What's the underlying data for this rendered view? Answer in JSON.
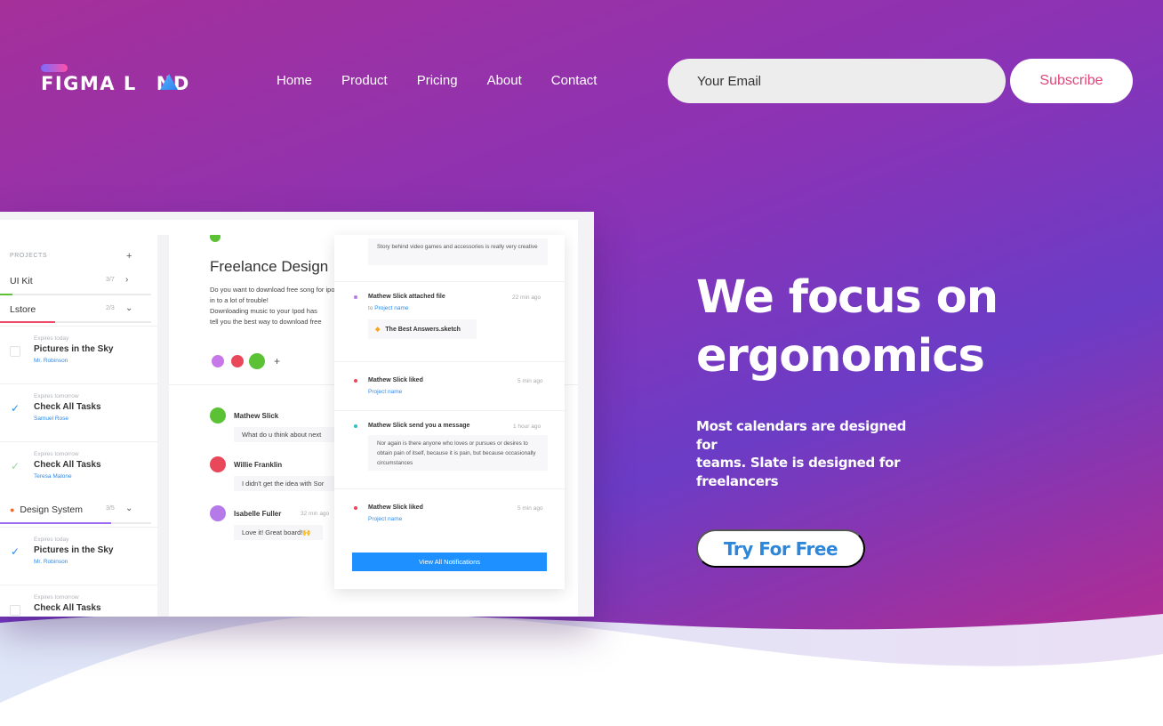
{
  "brand": {
    "name_left": "FIGMA L",
    "name_right": "ND",
    "accent_colors": [
      "#7a6bff",
      "#ff4fa8"
    ]
  },
  "nav": {
    "items": [
      "Home",
      "Product",
      "Pricing",
      "About",
      "Contact"
    ]
  },
  "signup": {
    "email_placeholder": "Your Email",
    "subscribe_label": "Subscribe"
  },
  "hero": {
    "headline_line1": "We focus on",
    "headline_line2": "ergonomics",
    "subtitle_line1": "Most calendars are designed for",
    "subtitle_line2": "teams. Slate is designed for",
    "subtitle_line3": "freelancers",
    "cta_label": "Try For Free"
  },
  "mockup": {
    "sidebar": {
      "header": "PROJECTS",
      "add_icon": "+",
      "projects": [
        {
          "name": "UI Kit",
          "count": "3/7"
        },
        {
          "name": "Lstore",
          "count": "2/3"
        }
      ],
      "tasks": [
        {
          "expires": "Expires today",
          "title": "Pictures in the Sky",
          "assignee": "Mr. Robinson",
          "done": false
        },
        {
          "expires": "Expires tomorrow",
          "title": "Check All Tasks",
          "assignee": "Samuel Rose",
          "done": true
        },
        {
          "expires": "Expires tomorrow",
          "title": "Check All Tasks",
          "assignee": "Teresa Malone",
          "done": true
        }
      ],
      "group": {
        "name": "Design System",
        "count": "3/5"
      },
      "group_tasks": [
        {
          "expires": "Expires today",
          "title": "Pictures in the Sky",
          "assignee": "Mr. Robinson",
          "done": true
        },
        {
          "expires": "Expires tomorrow",
          "title": "Check All Tasks",
          "assignee": "",
          "done": false
        }
      ]
    },
    "project": {
      "title": "Freelance Design",
      "desc_lines": [
        "Do you want to download free song for ipod? If so, reading this article could save you from getting",
        "in to a lot of trouble!",
        "Downloading music to your Ipod has",
        "tell you the best way to download free"
      ],
      "add_member": "+"
    },
    "messages": [
      {
        "name": "Mathew Slick",
        "time": "",
        "text": "What do u think about next"
      },
      {
        "name": "Willie Franklin",
        "time": "",
        "text": "I didn't get the idea with Sor"
      },
      {
        "name": "Isabelle Fuller",
        "time": "32 min ago",
        "text": "Love it! Great board!🙌"
      }
    ],
    "notifications": {
      "top_quote": "Story behind video games and accessories is really very creative",
      "items": [
        {
          "title": "Mathew Slick attached file",
          "time": "22 min ago",
          "link": "Project name",
          "file": "The Best Answers.sketch"
        },
        {
          "title": "Mathew Slick liked",
          "time": "5 min ago",
          "link": "Project name"
        },
        {
          "title": "Mathew Slick send you a message",
          "time": "1 hour ago",
          "quote": "Nor again is there anyone who loves or pursues or desires to obtain pain of itself, because it is pain, but because occasionally circumstances"
        },
        {
          "title": "Mathew Slick liked",
          "time": "5 min ago",
          "link": "Project name"
        }
      ],
      "link_prefix": "to",
      "view_all_label": "View All Notifications"
    }
  }
}
